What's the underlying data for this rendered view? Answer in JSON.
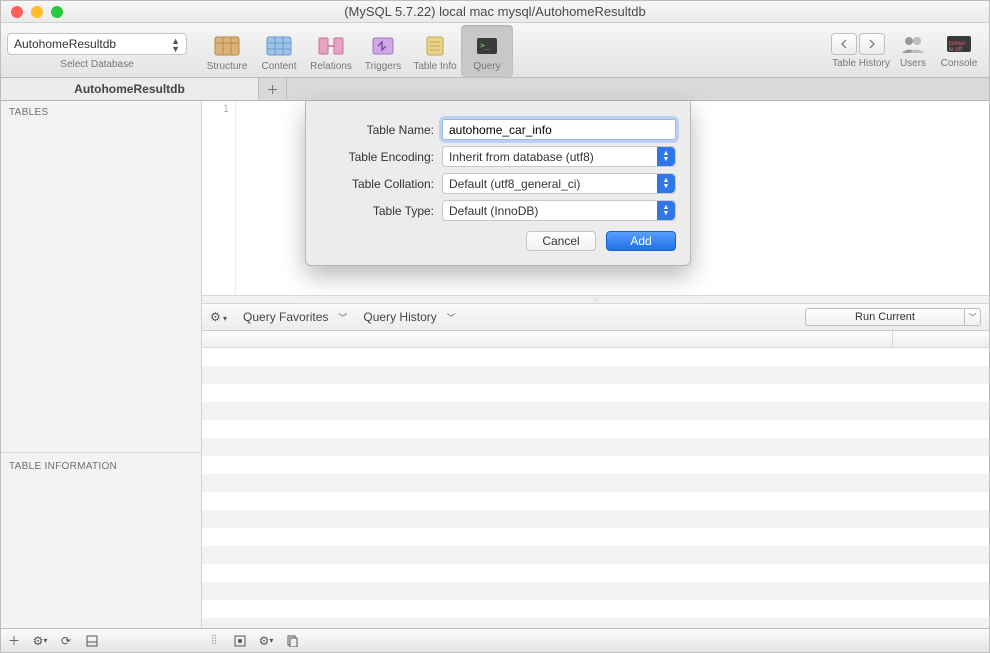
{
  "window": {
    "title": "(MySQL 5.7.22) local mac mysql/AutohomeResultdb"
  },
  "db_selector": {
    "value": "AutohomeResultdb",
    "label": "Select Database"
  },
  "toolbar": {
    "structure": "Structure",
    "content": "Content",
    "relations": "Relations",
    "triggers": "Triggers",
    "tableinfo": "Table Info",
    "query": "Query",
    "history": "Table History",
    "users": "Users",
    "console": "Console"
  },
  "tabs": {
    "active": "AutohomeResultdb"
  },
  "sidebar": {
    "tables_header": "TABLES",
    "info_header": "TABLE INFORMATION"
  },
  "editor": {
    "line1": "1"
  },
  "querybar": {
    "favorites": "Query Favorites",
    "history": "Query History",
    "run": "Run Current"
  },
  "modal": {
    "labels": {
      "name": "Table Name:",
      "encoding": "Table Encoding:",
      "collation": "Table Collation:",
      "type": "Table Type:"
    },
    "values": {
      "name": "autohome_car_info",
      "encoding": "Inherit from database (utf8)",
      "collation": "Default (utf8_general_ci)",
      "type": "Default (InnoDB)"
    },
    "buttons": {
      "cancel": "Cancel",
      "add": "Add"
    }
  }
}
